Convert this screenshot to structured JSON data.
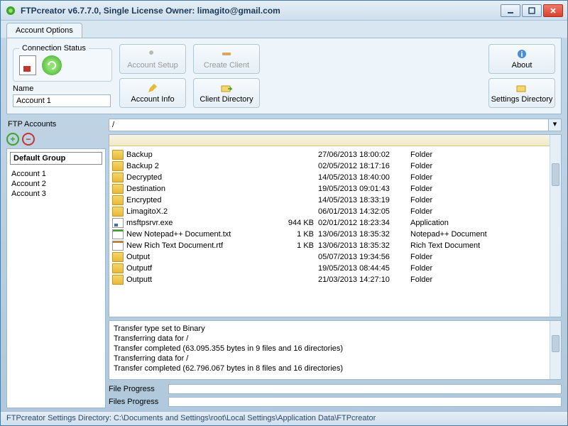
{
  "titlebar": {
    "title": "FTPcreator v6.7.7.0, Single License Owner: limagito@gmail.com"
  },
  "tabs": {
    "account_options": "Account Options"
  },
  "connection": {
    "legend": "Connection Status",
    "name_label": "Name",
    "name_value": "Account 1"
  },
  "toolbar": {
    "account_setup": "Account Setup",
    "account_info": "Account Info",
    "create_client": "Create Client",
    "client_directory": "Client Directory",
    "about": "About",
    "settings_directory": "Settings Directory"
  },
  "left": {
    "header": "FTP Accounts",
    "group": "Default Group",
    "accounts": [
      "Account 1",
      "Account 2",
      "Account 3"
    ]
  },
  "path": {
    "value": "/"
  },
  "files": [
    {
      "icon": "folder",
      "name": "Backup",
      "size": "",
      "date": "27/06/2013 18:00:02",
      "type": "Folder"
    },
    {
      "icon": "folder",
      "name": "Backup 2",
      "size": "",
      "date": "02/05/2012 18:17:16",
      "type": "Folder"
    },
    {
      "icon": "folder",
      "name": "Decrypted",
      "size": "",
      "date": "14/05/2013 18:40:00",
      "type": "Folder"
    },
    {
      "icon": "folder",
      "name": "Destination",
      "size": "",
      "date": "19/05/2013 09:01:43",
      "type": "Folder"
    },
    {
      "icon": "folder",
      "name": "Encrypted",
      "size": "",
      "date": "14/05/2013 18:33:19",
      "type": "Folder"
    },
    {
      "icon": "folder",
      "name": "LimagitoX.2",
      "size": "",
      "date": "06/01/2013 14:32:05",
      "type": "Folder"
    },
    {
      "icon": "exe",
      "name": "msftpsrvr.exe",
      "size": "944 KB",
      "date": "02/01/2012 18:23:34",
      "type": "Application"
    },
    {
      "icon": "txt",
      "name": "New Notepad++ Document.txt",
      "size": "1 KB",
      "date": "13/06/2013 18:35:32",
      "type": "Notepad++ Document"
    },
    {
      "icon": "rtf",
      "name": "New Rich Text Document.rtf",
      "size": "1 KB",
      "date": "13/06/2013 18:35:32",
      "type": "Rich Text Document"
    },
    {
      "icon": "folder",
      "name": "Output",
      "size": "",
      "date": "05/07/2013 19:34:56",
      "type": "Folder"
    },
    {
      "icon": "folder",
      "name": "Outputf",
      "size": "",
      "date": "19/05/2013 08:44:45",
      "type": "Folder"
    },
    {
      "icon": "folder",
      "name": "Outputt",
      "size": "",
      "date": "21/03/2013 14:27:10",
      "type": "Folder"
    }
  ],
  "log": [
    "Transfer type set to Binary",
    "Transferring data for /",
    "Transfer completed (63.095.355 bytes in 9 files and 16 directories)",
    "Transferring data for /",
    "Transfer completed (62.796.067 bytes in 8 files and 16 directories)"
  ],
  "progress": {
    "file_label": "File Progress",
    "files_label": "Files Progress"
  },
  "statusbar": "FTPcreator Settings Directory: C:\\Documents and Settings\\root\\Local Settings\\Application Data\\FTPcreator"
}
